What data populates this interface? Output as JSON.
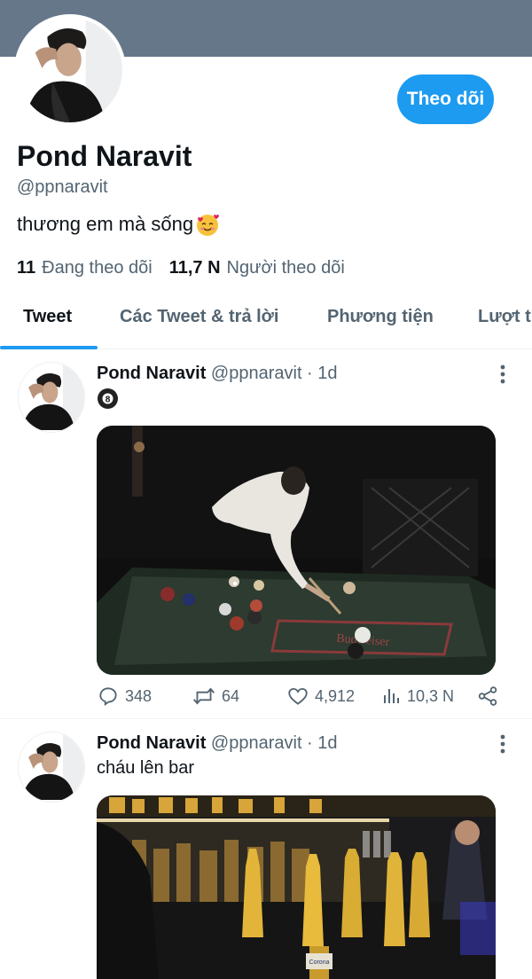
{
  "profile": {
    "follow_label": "Theo dõi",
    "name": "Pond Naravit",
    "handle": "@ppnaravit",
    "bio": "thương em mà sống",
    "bio_emoji": "smiling-face-with-hearts",
    "following_count": "11",
    "following_label": "Đang theo dõi",
    "followers_count": "11,7 N",
    "followers_label": "Người theo dõi"
  },
  "tabs": [
    "Tweet",
    "Các Tweet & trả lời",
    "Phương tiện",
    "Lượt thích"
  ],
  "tweets": [
    {
      "author": "Pond Naravit",
      "meta": "@ppnaravit · 1d",
      "text": "🎱",
      "image": "billiards-photo",
      "replies": "348",
      "retweets": "64",
      "likes": "4,912",
      "views": "10,3 N"
    },
    {
      "author": "Pond Naravit",
      "meta": "@ppnaravit · 1d",
      "text": "cháu lên bar",
      "image": "bar-photo"
    }
  ],
  "colors": {
    "banner": "#66778a",
    "accent": "#1d9bf0",
    "secondary_text": "#536471"
  }
}
